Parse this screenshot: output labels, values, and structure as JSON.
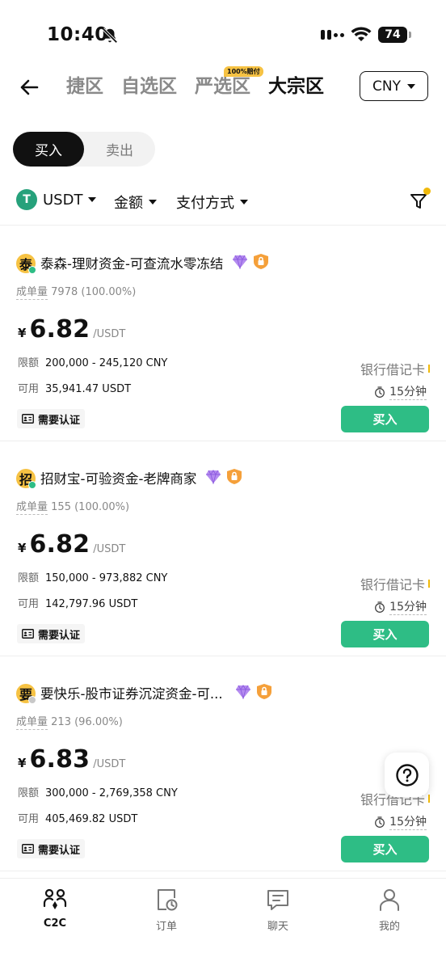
{
  "status_bar": {
    "time": "10:40",
    "battery": "74"
  },
  "nav": {
    "tabs": [
      {
        "label": "捷区",
        "active": false
      },
      {
        "label": "自选区",
        "active": false
      },
      {
        "label": "严选区",
        "active": false,
        "badge": "100%赔付"
      },
      {
        "label": "大宗区",
        "active": true
      }
    ],
    "currency": "CNY"
  },
  "segment": {
    "buy": "买入",
    "sell": "卖出"
  },
  "filters": {
    "coin": "USDT",
    "coin_symbol": "T",
    "amount": "金额",
    "payment": "支付方式"
  },
  "ads": [
    {
      "avatar": "泰",
      "online_color": "#2ebd85",
      "merchant": "泰森-理财资金-可查流水零冻结",
      "orders_label": "成单量",
      "orders": "7978 (100.00%)",
      "currency_symbol": "¥",
      "price": "6.82",
      "unit": "/USDT",
      "limit_label": "限额",
      "limit": "200,000 - 245,120 CNY",
      "available_label": "可用",
      "available": "35,941.47 USDT",
      "kyc": "需要认证",
      "payment_method": "银行借记卡",
      "time": "15分钟",
      "buy": "买入"
    },
    {
      "avatar": "招",
      "online_color": "#2ebd85",
      "merchant": "招财宝-可验资金-老牌商家",
      "orders_label": "成单量",
      "orders": "155 (100.00%)",
      "currency_symbol": "¥",
      "price": "6.82",
      "unit": "/USDT",
      "limit_label": "限额",
      "limit": "150,000 - 973,882 CNY",
      "available_label": "可用",
      "available": "142,797.96 USDT",
      "kyc": "需要认证",
      "payment_method": "银行借记卡",
      "time": "15分钟",
      "buy": "买入"
    },
    {
      "avatar": "要",
      "online_color": "#c8c8c8",
      "merchant": "要快乐-股市证券沉淀资金-可...",
      "orders_label": "成单量",
      "orders": "213 (96.00%)",
      "currency_symbol": "¥",
      "price": "6.83",
      "unit": "/USDT",
      "limit_label": "限额",
      "limit": "300,000 - 2,769,358 CNY",
      "available_label": "可用",
      "available": "405,469.82 USDT",
      "kyc": "需要认证",
      "payment_method": "银行借记卡",
      "time": "15分钟",
      "buy": "买入"
    }
  ],
  "bottom_nav": [
    {
      "label": "C2C",
      "icon": "c2c-icon",
      "active": true
    },
    {
      "label": "订单",
      "icon": "orders-icon",
      "active": false
    },
    {
      "label": "聊天",
      "icon": "chat-icon",
      "active": false
    },
    {
      "label": "我的",
      "icon": "profile-icon",
      "active": false
    }
  ],
  "colors": {
    "buy_green": "#2ebd85",
    "accent_yellow": "#f0b90b",
    "usdt_green": "#26a17b"
  }
}
